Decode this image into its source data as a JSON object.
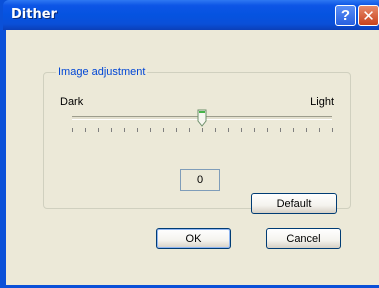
{
  "window": {
    "title": "Dither",
    "help_label": "?",
    "close_label": "✕",
    "help_icon": "question-mark-icon",
    "close_icon": "close-icon"
  },
  "group": {
    "legend": "Image adjustment",
    "slider": {
      "min_label": "Dark",
      "max_label": "Light",
      "value": 0,
      "position_fraction": 0.5,
      "tick_count": 21
    },
    "value_display": "0",
    "default_label": "Default"
  },
  "buttons": {
    "ok_label": "OK",
    "cancel_label": "Cancel"
  },
  "colors": {
    "titlebar": "#0a50d8",
    "dialog_bg": "#ece9d8",
    "legend": "#0046d5"
  }
}
